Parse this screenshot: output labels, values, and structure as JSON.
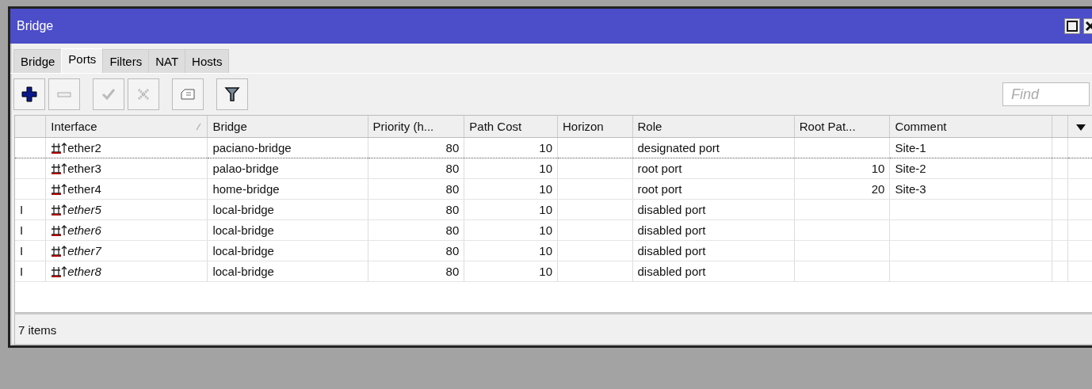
{
  "window": {
    "title": "Bridge"
  },
  "tabs": [
    {
      "label": "Bridge",
      "selected": false
    },
    {
      "label": "Ports",
      "selected": true
    },
    {
      "label": "Filters",
      "selected": false
    },
    {
      "label": "NAT",
      "selected": false
    },
    {
      "label": "Hosts",
      "selected": false
    }
  ],
  "toolbar": [
    {
      "kind": "add",
      "disabled": false
    },
    {
      "kind": "remove",
      "disabled": true
    },
    {
      "kind": "enable",
      "disabled": true
    },
    {
      "kind": "disable",
      "disabled": true
    },
    {
      "kind": "comment",
      "disabled": false
    },
    {
      "kind": "filter",
      "disabled": false
    }
  ],
  "search": {
    "placeholder": "Find"
  },
  "table": {
    "columns": [
      "Interface",
      "Bridge",
      "Priority (h...",
      "Path Cost",
      "Horizon",
      "Role",
      "Root Pat...",
      "Comment"
    ],
    "rows": [
      {
        "flag": "",
        "interface": "ether2",
        "bridge": "paciano-bridge",
        "priority": "80",
        "path_cost": "10",
        "horizon": "",
        "role": "designated port",
        "root_path_cost": "",
        "comment": "Site-1",
        "disabled": false,
        "focused": true
      },
      {
        "flag": "",
        "interface": "ether3",
        "bridge": "palao-bridge",
        "priority": "80",
        "path_cost": "10",
        "horizon": "",
        "role": "root port",
        "root_path_cost": "10",
        "comment": "Site-2",
        "disabled": false,
        "focused": false
      },
      {
        "flag": "",
        "interface": "ether4",
        "bridge": "home-bridge",
        "priority": "80",
        "path_cost": "10",
        "horizon": "",
        "role": "root port",
        "root_path_cost": "20",
        "comment": "Site-3",
        "disabled": false,
        "focused": false
      },
      {
        "flag": "I",
        "interface": "ether5",
        "bridge": "local-bridge",
        "priority": "80",
        "path_cost": "10",
        "horizon": "",
        "role": "disabled port",
        "root_path_cost": "",
        "comment": "",
        "disabled": true,
        "focused": false
      },
      {
        "flag": "I",
        "interface": "ether6",
        "bridge": "local-bridge",
        "priority": "80",
        "path_cost": "10",
        "horizon": "",
        "role": "disabled port",
        "root_path_cost": "",
        "comment": "",
        "disabled": true,
        "focused": false
      },
      {
        "flag": "I",
        "interface": "ether7",
        "bridge": "local-bridge",
        "priority": "80",
        "path_cost": "10",
        "horizon": "",
        "role": "disabled port",
        "root_path_cost": "",
        "comment": "",
        "disabled": true,
        "focused": false
      },
      {
        "flag": "I",
        "interface": "ether8",
        "bridge": "local-bridge",
        "priority": "80",
        "path_cost": "10",
        "horizon": "",
        "role": "disabled port",
        "root_path_cost": "",
        "comment": "",
        "disabled": true,
        "focused": false
      }
    ]
  },
  "status_bar": "7 items"
}
